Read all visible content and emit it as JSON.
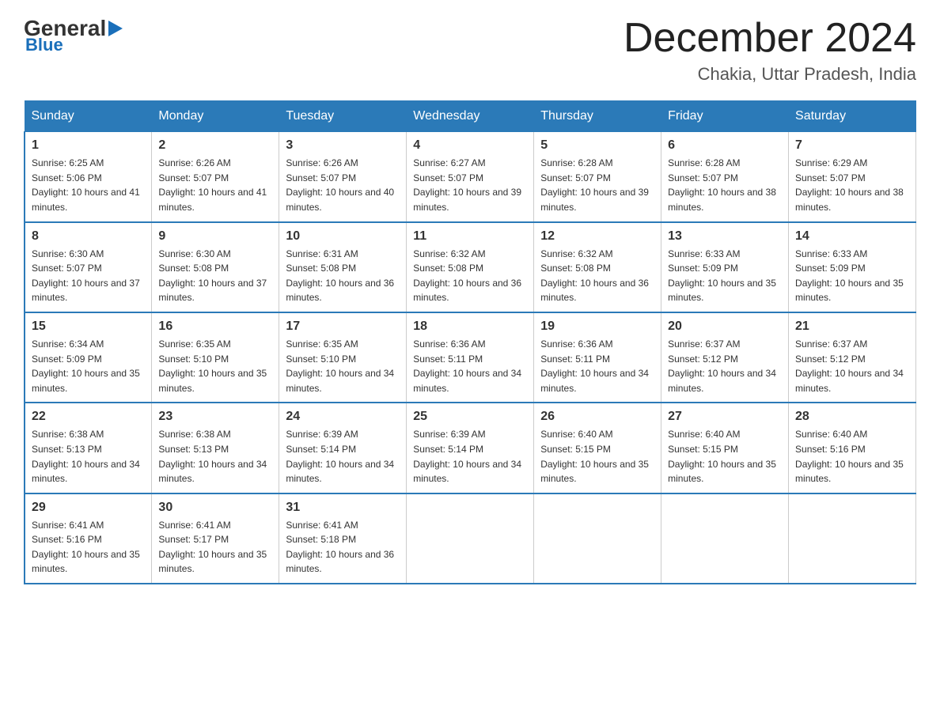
{
  "logo": {
    "general": "General",
    "blue": "Blue"
  },
  "title": "December 2024",
  "location": "Chakia, Uttar Pradesh, India",
  "days_of_week": [
    "Sunday",
    "Monday",
    "Tuesday",
    "Wednesday",
    "Thursday",
    "Friday",
    "Saturday"
  ],
  "weeks": [
    [
      {
        "day": "1",
        "sunrise": "Sunrise: 6:25 AM",
        "sunset": "Sunset: 5:06 PM",
        "daylight": "Daylight: 10 hours and 41 minutes."
      },
      {
        "day": "2",
        "sunrise": "Sunrise: 6:26 AM",
        "sunset": "Sunset: 5:07 PM",
        "daylight": "Daylight: 10 hours and 41 minutes."
      },
      {
        "day": "3",
        "sunrise": "Sunrise: 6:26 AM",
        "sunset": "Sunset: 5:07 PM",
        "daylight": "Daylight: 10 hours and 40 minutes."
      },
      {
        "day": "4",
        "sunrise": "Sunrise: 6:27 AM",
        "sunset": "Sunset: 5:07 PM",
        "daylight": "Daylight: 10 hours and 39 minutes."
      },
      {
        "day": "5",
        "sunrise": "Sunrise: 6:28 AM",
        "sunset": "Sunset: 5:07 PM",
        "daylight": "Daylight: 10 hours and 39 minutes."
      },
      {
        "day": "6",
        "sunrise": "Sunrise: 6:28 AM",
        "sunset": "Sunset: 5:07 PM",
        "daylight": "Daylight: 10 hours and 38 minutes."
      },
      {
        "day": "7",
        "sunrise": "Sunrise: 6:29 AM",
        "sunset": "Sunset: 5:07 PM",
        "daylight": "Daylight: 10 hours and 38 minutes."
      }
    ],
    [
      {
        "day": "8",
        "sunrise": "Sunrise: 6:30 AM",
        "sunset": "Sunset: 5:07 PM",
        "daylight": "Daylight: 10 hours and 37 minutes."
      },
      {
        "day": "9",
        "sunrise": "Sunrise: 6:30 AM",
        "sunset": "Sunset: 5:08 PM",
        "daylight": "Daylight: 10 hours and 37 minutes."
      },
      {
        "day": "10",
        "sunrise": "Sunrise: 6:31 AM",
        "sunset": "Sunset: 5:08 PM",
        "daylight": "Daylight: 10 hours and 36 minutes."
      },
      {
        "day": "11",
        "sunrise": "Sunrise: 6:32 AM",
        "sunset": "Sunset: 5:08 PM",
        "daylight": "Daylight: 10 hours and 36 minutes."
      },
      {
        "day": "12",
        "sunrise": "Sunrise: 6:32 AM",
        "sunset": "Sunset: 5:08 PM",
        "daylight": "Daylight: 10 hours and 36 minutes."
      },
      {
        "day": "13",
        "sunrise": "Sunrise: 6:33 AM",
        "sunset": "Sunset: 5:09 PM",
        "daylight": "Daylight: 10 hours and 35 minutes."
      },
      {
        "day": "14",
        "sunrise": "Sunrise: 6:33 AM",
        "sunset": "Sunset: 5:09 PM",
        "daylight": "Daylight: 10 hours and 35 minutes."
      }
    ],
    [
      {
        "day": "15",
        "sunrise": "Sunrise: 6:34 AM",
        "sunset": "Sunset: 5:09 PM",
        "daylight": "Daylight: 10 hours and 35 minutes."
      },
      {
        "day": "16",
        "sunrise": "Sunrise: 6:35 AM",
        "sunset": "Sunset: 5:10 PM",
        "daylight": "Daylight: 10 hours and 35 minutes."
      },
      {
        "day": "17",
        "sunrise": "Sunrise: 6:35 AM",
        "sunset": "Sunset: 5:10 PM",
        "daylight": "Daylight: 10 hours and 34 minutes."
      },
      {
        "day": "18",
        "sunrise": "Sunrise: 6:36 AM",
        "sunset": "Sunset: 5:11 PM",
        "daylight": "Daylight: 10 hours and 34 minutes."
      },
      {
        "day": "19",
        "sunrise": "Sunrise: 6:36 AM",
        "sunset": "Sunset: 5:11 PM",
        "daylight": "Daylight: 10 hours and 34 minutes."
      },
      {
        "day": "20",
        "sunrise": "Sunrise: 6:37 AM",
        "sunset": "Sunset: 5:12 PM",
        "daylight": "Daylight: 10 hours and 34 minutes."
      },
      {
        "day": "21",
        "sunrise": "Sunrise: 6:37 AM",
        "sunset": "Sunset: 5:12 PM",
        "daylight": "Daylight: 10 hours and 34 minutes."
      }
    ],
    [
      {
        "day": "22",
        "sunrise": "Sunrise: 6:38 AM",
        "sunset": "Sunset: 5:13 PM",
        "daylight": "Daylight: 10 hours and 34 minutes."
      },
      {
        "day": "23",
        "sunrise": "Sunrise: 6:38 AM",
        "sunset": "Sunset: 5:13 PM",
        "daylight": "Daylight: 10 hours and 34 minutes."
      },
      {
        "day": "24",
        "sunrise": "Sunrise: 6:39 AM",
        "sunset": "Sunset: 5:14 PM",
        "daylight": "Daylight: 10 hours and 34 minutes."
      },
      {
        "day": "25",
        "sunrise": "Sunrise: 6:39 AM",
        "sunset": "Sunset: 5:14 PM",
        "daylight": "Daylight: 10 hours and 34 minutes."
      },
      {
        "day": "26",
        "sunrise": "Sunrise: 6:40 AM",
        "sunset": "Sunset: 5:15 PM",
        "daylight": "Daylight: 10 hours and 35 minutes."
      },
      {
        "day": "27",
        "sunrise": "Sunrise: 6:40 AM",
        "sunset": "Sunset: 5:15 PM",
        "daylight": "Daylight: 10 hours and 35 minutes."
      },
      {
        "day": "28",
        "sunrise": "Sunrise: 6:40 AM",
        "sunset": "Sunset: 5:16 PM",
        "daylight": "Daylight: 10 hours and 35 minutes."
      }
    ],
    [
      {
        "day": "29",
        "sunrise": "Sunrise: 6:41 AM",
        "sunset": "Sunset: 5:16 PM",
        "daylight": "Daylight: 10 hours and 35 minutes."
      },
      {
        "day": "30",
        "sunrise": "Sunrise: 6:41 AM",
        "sunset": "Sunset: 5:17 PM",
        "daylight": "Daylight: 10 hours and 35 minutes."
      },
      {
        "day": "31",
        "sunrise": "Sunrise: 6:41 AM",
        "sunset": "Sunset: 5:18 PM",
        "daylight": "Daylight: 10 hours and 36 minutes."
      },
      null,
      null,
      null,
      null
    ]
  ]
}
